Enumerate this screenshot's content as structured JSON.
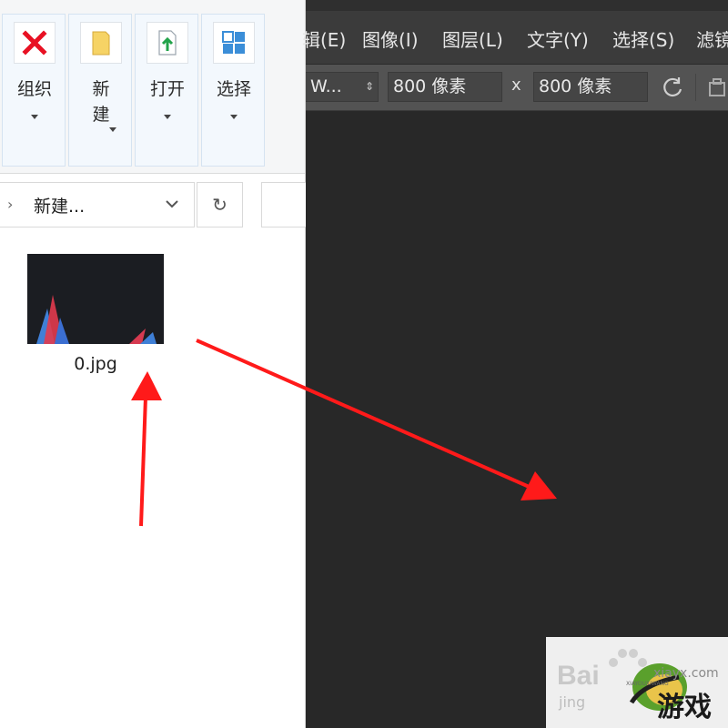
{
  "explorer": {
    "ribbon": {
      "groups": [
        {
          "label": "组织",
          "icon": "delete-x-icon"
        },
        {
          "label": "新\n建",
          "icon": "new-folder-icon"
        },
        {
          "label": "打开",
          "icon": "open-file-icon"
        },
        {
          "label": "选择",
          "icon": "select-grid-icon"
        }
      ]
    },
    "address": {
      "path": "新建..."
    },
    "file": {
      "name": "0.jpg"
    }
  },
  "editor": {
    "menu": [
      "辑(E)",
      "图像(I)",
      "图层(L)",
      "文字(Y)",
      "选择(S)",
      "滤镜"
    ],
    "options": {
      "preset": "W...",
      "width": "800 像素",
      "separator": "x",
      "height": "800 像素"
    }
  },
  "watermark": {
    "left_text": "Bai",
    "left_sub": "jing",
    "domain": "xiayx.com",
    "brand_small": "XIAYOUXIWANG",
    "brand_cn": "游戏"
  },
  "colors": {
    "arrow": "#ff1a1a",
    "delete_icon": "#e81123",
    "folder_icon": "#f6d365",
    "open_arrow": "#22a34a",
    "select_icon": "#3b8ed8"
  }
}
